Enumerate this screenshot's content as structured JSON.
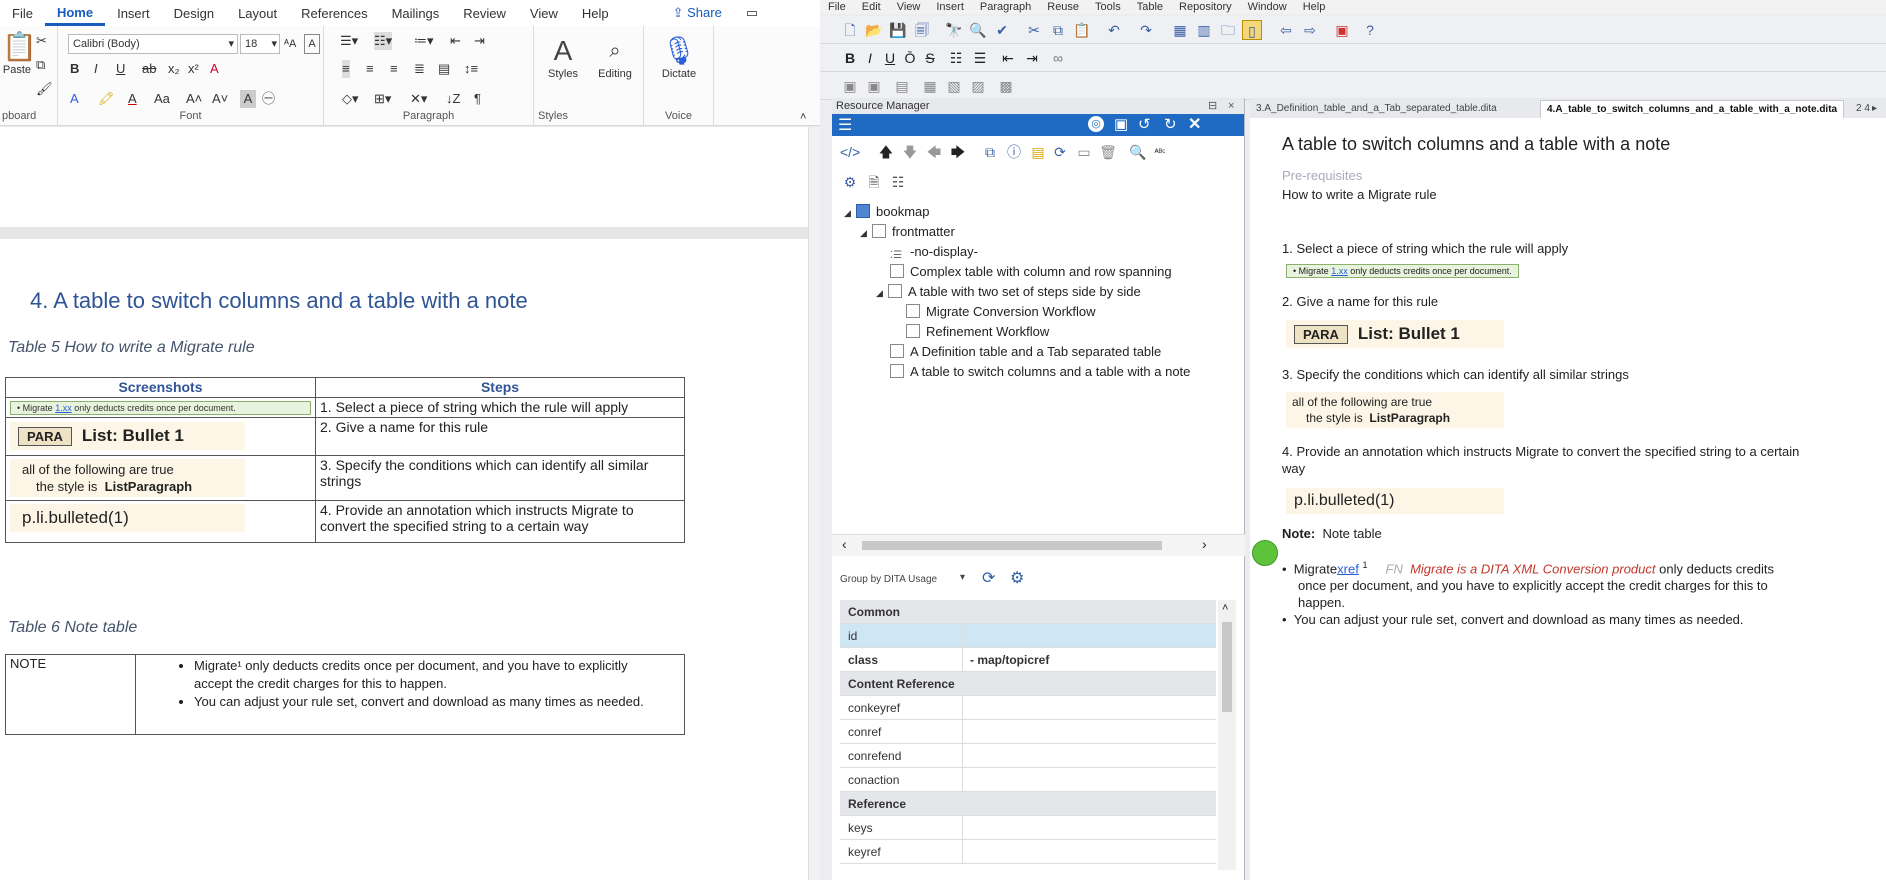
{
  "word": {
    "menu": [
      "File",
      "Home",
      "Insert",
      "Design",
      "Layout",
      "References",
      "Mailings",
      "Review",
      "View",
      "Help"
    ],
    "share_label": "Share",
    "font_name": "Calibri (Body)",
    "font_size": "18",
    "paste_label": "Paste",
    "clipboard_label": "pboard",
    "font_group": "Font",
    "paragraph_group": "Paragraph",
    "styles_group": "Styles",
    "voice_group": "Voice",
    "styles_btn": "Styles",
    "editing_btn": "Editing",
    "dictate_btn": "Dictate",
    "heading": "4. A table to switch columns and a table with a note",
    "table5_caption": "Table 5 How to write a Migrate rule",
    "table5": {
      "col1": "Screenshots",
      "col2": "Steps",
      "strip_pre": "• Migrate",
      "strip_link": "1.xx",
      "strip_post": "only deducts credits once per document.",
      "para_tag": "PARA",
      "bullet": "List: Bullet 1",
      "cond1": "all of the following are true",
      "cond2_pre": "the style is",
      "cond2_bold": "ListParagraph",
      "annot": "p.li.bulleted(1)",
      "steps": [
        "1. Select a piece of string which the rule will apply",
        "2. Give a name for this rule",
        "3. Specify the conditions which can identify all similar strings",
        "4. Provide an annotation which instructs Migrate to convert the specified string to a certain way"
      ]
    },
    "table6_caption": "Table 6 Note table",
    "table6": {
      "label": "NOTE",
      "b1": "Migrate¹ only deducts credits once per document, and you have to explicitly accept the credit charges for this to happen.",
      "b2": "You can adjust your rule set, convert and download as many times as needed."
    }
  },
  "oxygen": {
    "menu": [
      "File",
      "Edit",
      "View",
      "Insert",
      "Paragraph",
      "Reuse",
      "Tools",
      "Table",
      "Repository",
      "Window",
      "Help"
    ],
    "rm_title": "Resource Manager",
    "tree": {
      "root": "bookmap",
      "frontmatter": "frontmatter",
      "nodisplay": "-no-display-",
      "t1": "Complex table with column and row spanning",
      "t2": "A table with two set of steps side by side",
      "t2a": "Migrate Conversion Workflow",
      "t2b": "Refinement Workflow",
      "t3": "A Definition table and a Tab separated table",
      "t4": "A table to switch columns and a table with a note"
    },
    "group_label": "Group by DITA Usage",
    "props": {
      "common": "Common",
      "id": "id",
      "class": "class",
      "class_val": "- map/topicref",
      "content_ref": "Content Reference",
      "conkeyref": "conkeyref",
      "conref": "conref",
      "conrefend": "conrefend",
      "conaction": "conaction",
      "reference": "Reference",
      "keys": "keys",
      "keyref": "keyref"
    },
    "tabs": {
      "t1": "3.A_Definition_table_and_a_Tab_separated_table.dita",
      "t2": "4.A_table_to_switch_columns_and_a_table_with_a_note.dita",
      "t3": "2 4"
    },
    "editor": {
      "title": "A table to switch columns and a table with a note",
      "prereq": "Pre-requisites",
      "subtitle": "How to write a Migrate rule",
      "s1": "1. Select a piece of string which the rule will apply",
      "strip_pre": "• Migrate",
      "strip_link": "1.xx",
      "strip_post": "only deducts credits once per document.",
      "s2": "2. Give a name for this rule",
      "para_tag": "PARA",
      "bullet": "List: Bullet 1",
      "s3": "3. Specify the conditions which can identify all similar strings",
      "cond1": "all of the following are true",
      "cond2_pre": "the style is",
      "cond2_bold": "ListParagraph",
      "s4a": "4. Provide an annotation which instructs Migrate to convert the specified string to a certain",
      "s4b": "way",
      "annot": "p.li.bulleted(1)",
      "note_label": "Note:",
      "note_title": "Note table",
      "b1_pre": "Migrate",
      "b1_xref": "xref",
      "b1_sup": "1",
      "b1_fn": "FN",
      "b1_fn_text": "Migrate is a DITA XML Conversion product",
      "b1_post": "only deducts credits",
      "b1_l2": "once per document, and you have to explicitly accept the credit charges for this to",
      "b1_l3": "happen.",
      "b2": "You can adjust your rule set, convert and download as many times as needed."
    }
  }
}
